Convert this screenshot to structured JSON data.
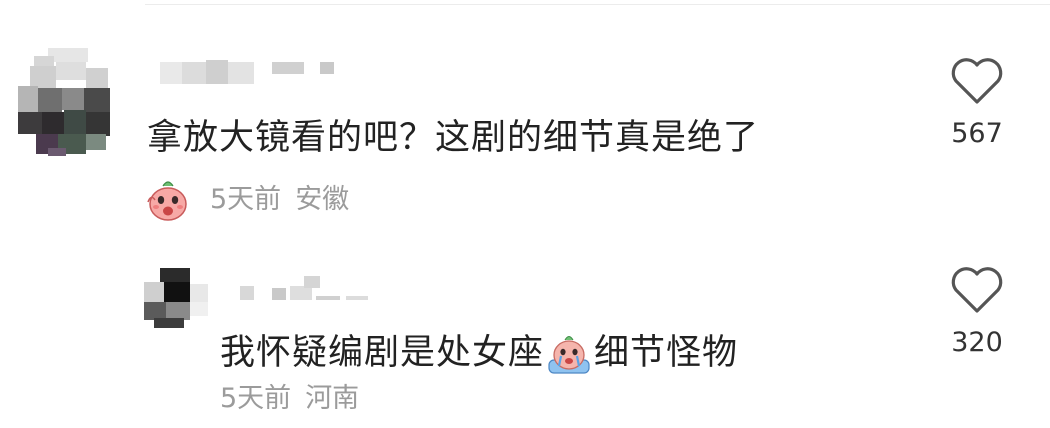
{
  "comments": [
    {
      "text": "拿放大镜看的吧？这剧的细节真是绝了",
      "time": "5天前",
      "location": "安徽",
      "likes": "567",
      "badge_icon": "pink-face-badge-icon"
    },
    {
      "text_before": "我怀疑编剧是处女座",
      "emoji_icon": "crying-peach-emoji-icon",
      "text_after": "细节怪物",
      "time": "5天前",
      "location": "河南",
      "likes": "320"
    }
  ],
  "colors": {
    "text": "#222222",
    "meta": "#9b9b9b",
    "heart": "#555555"
  }
}
